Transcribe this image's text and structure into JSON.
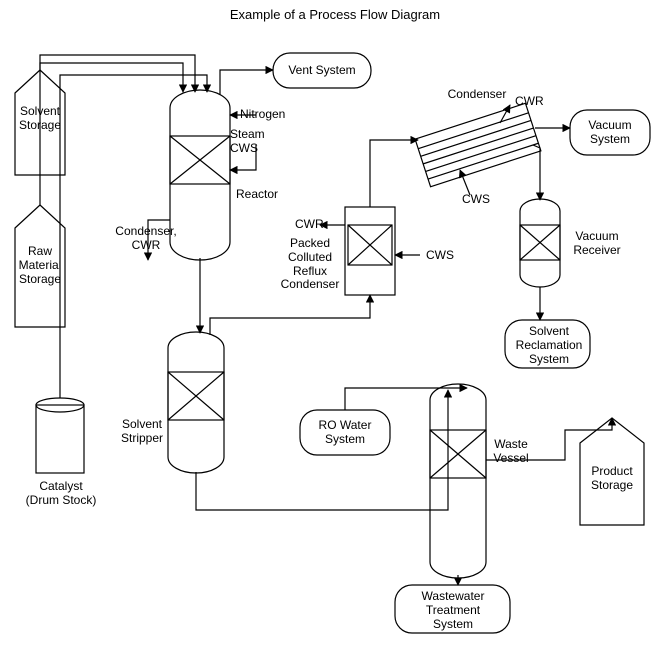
{
  "title": "Example of a Process Flow Diagram",
  "nodes": {
    "solventStorage": "Solvent\nStorage",
    "rawMaterialStorage": "Raw\nMaterial\nStorage",
    "catalyst": "Catalyst\n(Drum Stock)",
    "reactor": "Reactor",
    "ventSystem": "Vent System",
    "condenserCWR": "Condenser,\nCWR",
    "solventStripper": "Solvent\nStripper",
    "packedCondenser": "Packed\nColluted\nReflux\nCondenser",
    "condenser2": "Condenser",
    "vacuumSystem": "Vacuum\nSystem",
    "vacuumReceiver": "Vacuum\nReceiver",
    "solventReclamation": "Solvent\nReclamation\nSystem",
    "roWater": "RO Water\nSystem",
    "wasteVessel": "Waste\nVessel",
    "wastewater": "Wastewater\nTreatment\nSystem",
    "productStorage": "Product\nStorage"
  },
  "labels": {
    "nitrogen": "Nitrogen",
    "steamCWS": "Steam\nCWS",
    "cwr1": "CWR",
    "cws1": "CWS",
    "cwr2": "CWR",
    "cws2": "CWS"
  }
}
